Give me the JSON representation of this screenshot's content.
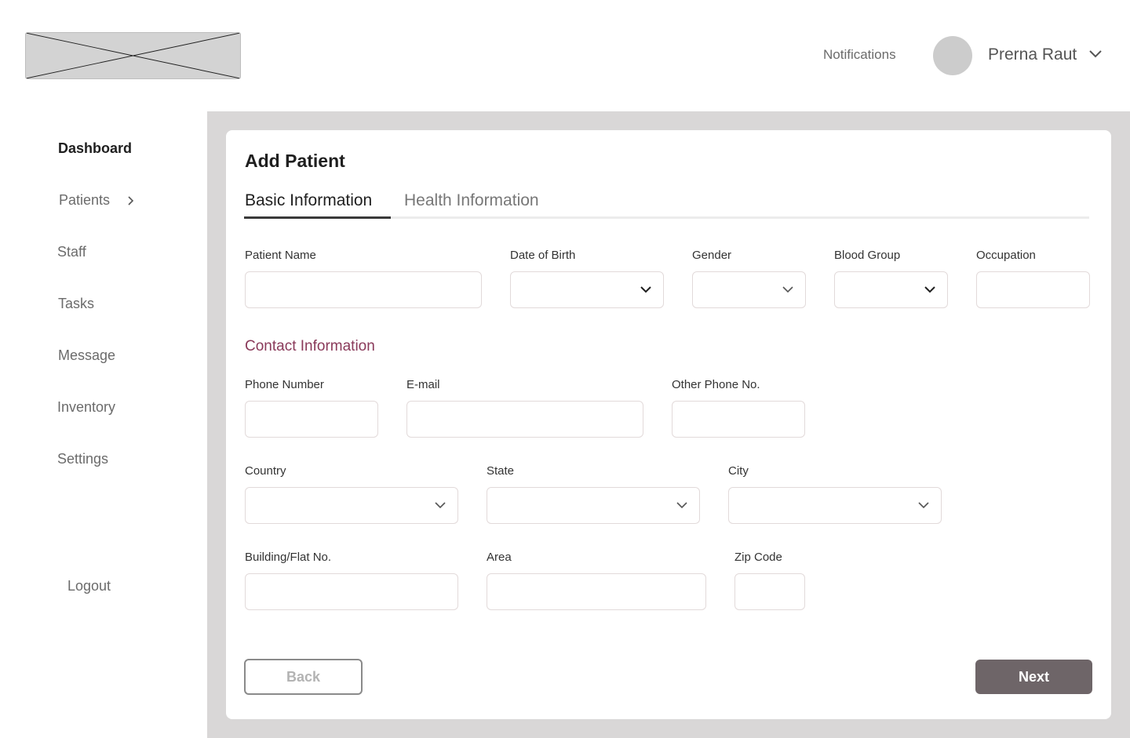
{
  "header": {
    "notifications_label": "Notifications",
    "user_name": "Prerna Raut"
  },
  "sidebar": {
    "items": [
      {
        "label": "Dashboard",
        "active": true
      },
      {
        "label": "Patients"
      },
      {
        "label": "Staff"
      },
      {
        "label": "Tasks"
      },
      {
        "label": "Message"
      },
      {
        "label": "Inventory"
      },
      {
        "label": "Settings"
      }
    ],
    "logout_label": "Logout"
  },
  "page": {
    "title": "Add Patient",
    "tabs": [
      {
        "label": "Basic Information",
        "active": true
      },
      {
        "label": "Health Information"
      }
    ]
  },
  "form": {
    "basic": {
      "patient_name": {
        "label": "Patient Name",
        "value": ""
      },
      "date_of_birth": {
        "label": "Date of Birth",
        "value": ""
      },
      "gender": {
        "label": "Gender",
        "value": ""
      },
      "blood_group": {
        "label": "Blood Group",
        "value": ""
      },
      "occupation": {
        "label": "Occupation",
        "value": ""
      }
    },
    "contact_section_title": "Contact Information",
    "contact": {
      "phone_number": {
        "label": "Phone Number",
        "value": ""
      },
      "email": {
        "label": "E-mail",
        "value": ""
      },
      "other_phone": {
        "label": "Other Phone No.",
        "value": ""
      },
      "country": {
        "label": "Country",
        "value": ""
      },
      "state": {
        "label": "State",
        "value": ""
      },
      "city": {
        "label": "City",
        "value": ""
      },
      "building": {
        "label": "Building/Flat No.",
        "value": ""
      },
      "area": {
        "label": "Area",
        "value": ""
      },
      "zip_code": {
        "label": "Zip Code",
        "value": ""
      }
    }
  },
  "actions": {
    "back_label": "Back",
    "next_label": "Next"
  },
  "colors": {
    "accent": "#8a3a5a",
    "primary_button": "#6e6568",
    "main_background": "#d9d7d7"
  },
  "icons": {
    "logo": "logo-placeholder-icon",
    "user_menu": "chevron-down-icon",
    "patients_expand": "chevron-right-icon",
    "select": "chevron-down-icon"
  }
}
